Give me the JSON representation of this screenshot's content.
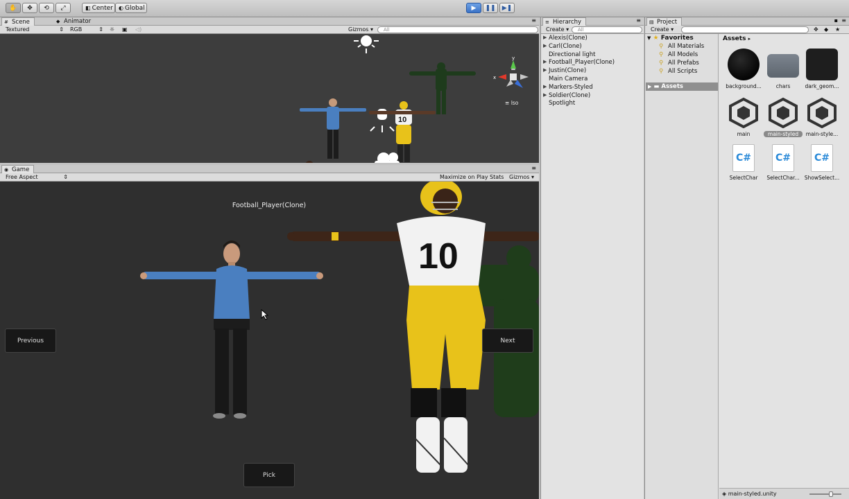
{
  "toolbar": {
    "tools": [
      "hand-icon",
      "move-icon",
      "rotate-icon",
      "scale-icon"
    ],
    "center_label": "Center",
    "global_label": "Global",
    "play_icons": [
      "play-icon",
      "pause-icon",
      "step-icon"
    ]
  },
  "scene": {
    "tab_label": "Scene",
    "animator_tab_label": "Animator",
    "render_mode": "Textured",
    "color_mode": "RGB",
    "gizmos_label": "Gizmos",
    "search_placeholder": "All",
    "iso_label": "Iso"
  },
  "game": {
    "tab_label": "Game",
    "aspect": "Free Aspect",
    "maximize_label": "Maximize on Play",
    "stats_label": "Stats",
    "gizmos_label": "Gizmos",
    "character_name": "Football_Player(Clone)",
    "previous_label": "Previous",
    "next_label": "Next",
    "pick_label": "Pick",
    "jersey_number": "10"
  },
  "hierarchy": {
    "tab_label": "Hierarchy",
    "create_label": "Create",
    "search_placeholder": "All",
    "items": [
      {
        "label": "Alexis(Clone)",
        "expandable": true
      },
      {
        "label": "Carl(Clone)",
        "expandable": true
      },
      {
        "label": "Directional light",
        "expandable": false
      },
      {
        "label": "Football_Player(Clone)",
        "expandable": true
      },
      {
        "label": "Justin(Clone)",
        "expandable": true
      },
      {
        "label": "Main Camera",
        "expandable": false
      },
      {
        "label": "Markers-Styled",
        "expandable": true
      },
      {
        "label": "Soldier(Clone)",
        "expandable": true
      },
      {
        "label": "Spotlight",
        "expandable": false
      }
    ]
  },
  "project": {
    "tab_label": "Project",
    "create_label": "Create",
    "favorites_label": "Favorites",
    "favorites": [
      "All Materials",
      "All Models",
      "All Prefabs",
      "All Scripts"
    ],
    "assets_folder_label": "Assets",
    "assets_header": "Assets",
    "assets": [
      {
        "label": "background...",
        "kind": "material"
      },
      {
        "label": "chars",
        "kind": "folder"
      },
      {
        "label": "dark_geom...",
        "kind": "material"
      },
      {
        "label": "main",
        "kind": "scene"
      },
      {
        "label": "main-styled",
        "kind": "scene",
        "selected": true
      },
      {
        "label": "main-style...",
        "kind": "scene"
      },
      {
        "label": "SelectChar",
        "kind": "script"
      },
      {
        "label": "SelectChar...",
        "kind": "script"
      },
      {
        "label": "ShowSelect...",
        "kind": "script"
      }
    ],
    "status_file": "main-styled.unity"
  },
  "colors": {
    "game_bg": "#2f2f2f",
    "scene_bg": "#3c3c3c",
    "selection": "#3a72c6",
    "yellow": "#e8c21a",
    "blue_shirt": "#4a7fc0"
  }
}
